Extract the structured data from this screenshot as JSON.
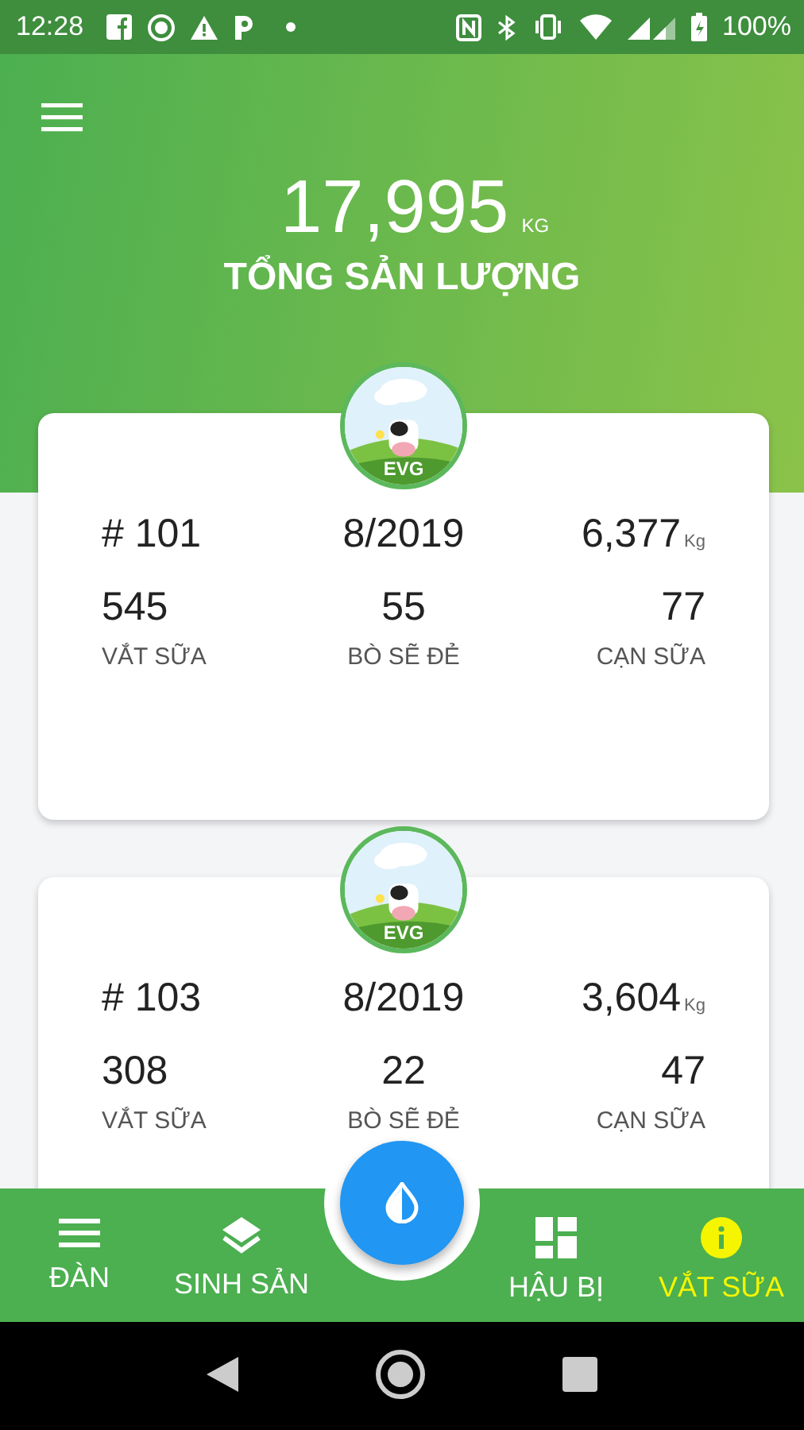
{
  "status_bar": {
    "time": "12:28",
    "battery": "100%"
  },
  "header": {
    "total": "17,995",
    "unit": "KG",
    "label": "TỔNG SẢN LƯỢNG"
  },
  "farms": [
    {
      "logo_text": "EVG",
      "id": "# 101",
      "period": "8/2019",
      "yield": "6,377",
      "yield_unit": "Kg",
      "stats": [
        {
          "value": "545",
          "label": "VẮT SỮA"
        },
        {
          "value": "55",
          "label": "BÒ SẼ ĐẺ"
        },
        {
          "value": "77",
          "label": "CẠN SỮA"
        }
      ]
    },
    {
      "logo_text": "EVG",
      "id": "# 103",
      "period": "8/2019",
      "yield": "3,604",
      "yield_unit": "Kg",
      "stats": [
        {
          "value": "308",
          "label": "VẮT SỮA"
        },
        {
          "value": "22",
          "label": "BÒ SẼ ĐẺ"
        },
        {
          "value": "47",
          "label": "CẠN SỮA"
        }
      ]
    }
  ],
  "bottom_nav": [
    {
      "kind": "menu",
      "label": "ĐÀN",
      "selected": false
    },
    {
      "kind": "layers",
      "label": "SINH SẢN",
      "selected": false
    },
    {
      "kind": "grid",
      "label": "HẬU BỊ",
      "selected": false
    },
    {
      "kind": "info",
      "label": "VẮT SỮA",
      "selected": true
    }
  ]
}
